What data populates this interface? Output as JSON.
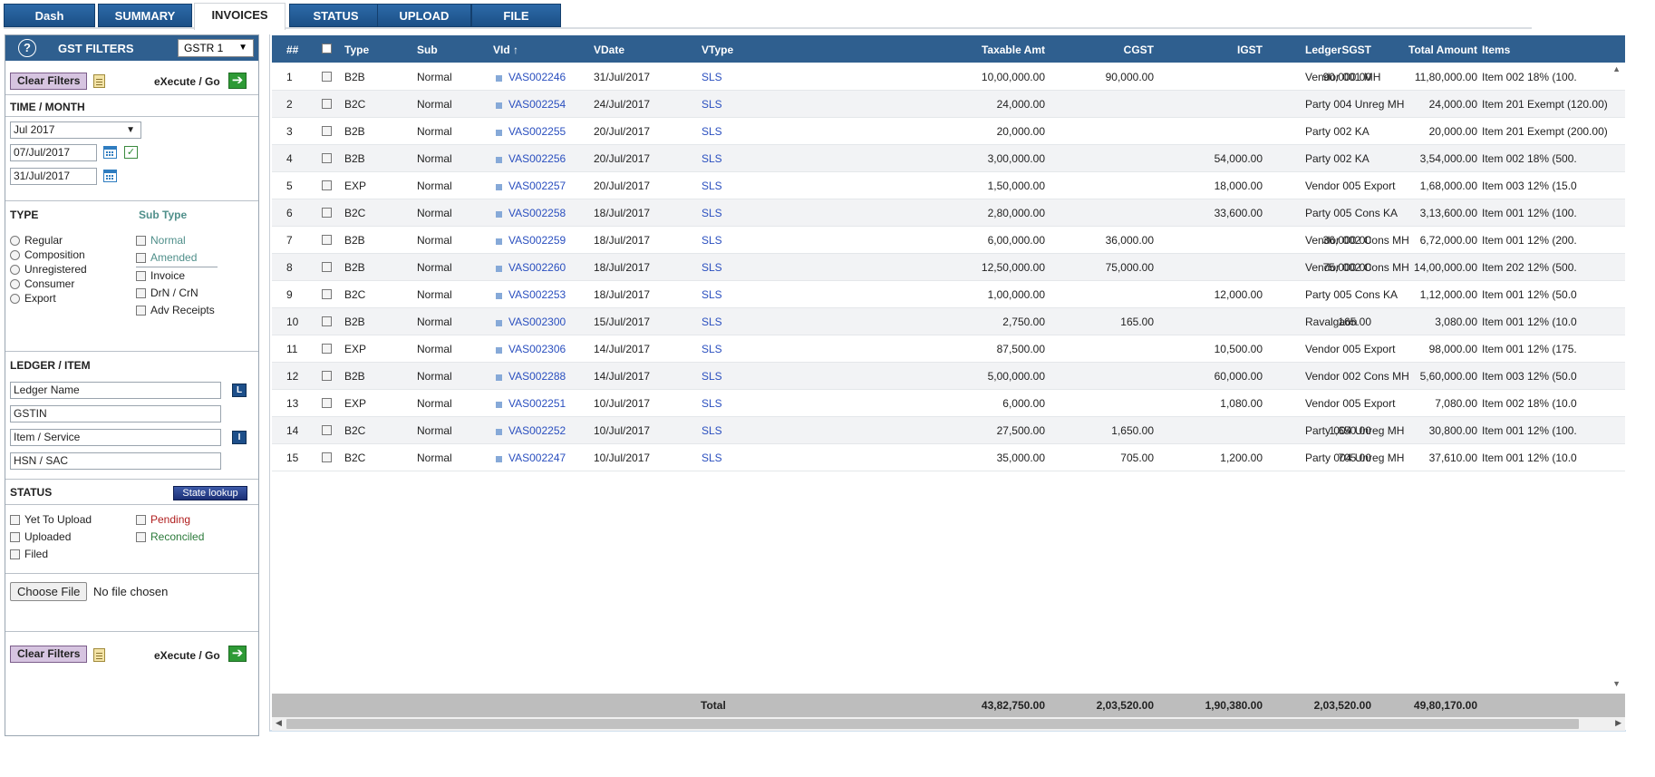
{
  "tabs": [
    "Dash",
    "SUMMARY",
    "INVOICES",
    "STATUS",
    "UPLOAD",
    "FILE"
  ],
  "sidebar": {
    "title": "GST FILTERS",
    "gstr_value": "GSTR 1",
    "clear_label": "Clear Filters",
    "execute_label": "eXecute / Go",
    "time_title": "TIME / MONTH",
    "month_value": "Jul 2017",
    "from_date": "07/Jul/2017",
    "to_date": "31/Jul/2017",
    "type_title": "TYPE",
    "subtype_title": "Sub Type",
    "types": [
      "Regular",
      "Composition",
      "Unregistered",
      "Consumer",
      "Export"
    ],
    "subtypes": [
      "Normal",
      "Amended"
    ],
    "doc_types": [
      "Invoice",
      "DrN / CrN",
      "Adv Receipts"
    ],
    "ledger_title": "LEDGER / ITEM",
    "ledger_placeholder": "Ledger Name",
    "gstin_placeholder": "GSTIN",
    "item_placeholder": "Item / Service",
    "hsn_placeholder": "HSN / SAC",
    "ledger_btn": "L",
    "item_btn": "I",
    "status_title": "STATUS",
    "state_lookup": "State lookup",
    "status_left": [
      "Yet To Upload",
      "Uploaded",
      "Filed"
    ],
    "status_pending": "Pending",
    "status_reconciled": "Reconciled",
    "choose_file": "Choose File",
    "no_file": "No file chosen"
  },
  "grid": {
    "headers": {
      "num": "##",
      "type": "Type",
      "sub": "Sub",
      "vid": "VId",
      "vdate": "VDate",
      "vtype": "VType",
      "taxable": "Taxable Amt",
      "cgst": "CGST",
      "igst": "IGST",
      "sgst": "SGST",
      "total": "Total Amount",
      "ledger": "Ledger",
      "items": "Items"
    },
    "sort_indicator": "↑",
    "rows": [
      {
        "n": "1",
        "type": "B2B",
        "sub": "Normal",
        "vid": "VAS002246",
        "vdate": "31/Jul/2017",
        "vtype": "SLS",
        "taxable": "10,00,000.00",
        "cgst": "90,000.00",
        "igst": "",
        "sgst": "90,000.00",
        "total": "11,80,000.00",
        "ledger": "Vendor 001 MH",
        "items": "Item 002 18% (100."
      },
      {
        "n": "2",
        "type": "B2C",
        "sub": "Normal",
        "vid": "VAS002254",
        "vdate": "24/Jul/2017",
        "vtype": "SLS",
        "taxable": "24,000.00",
        "cgst": "",
        "igst": "",
        "sgst": "",
        "total": "24,000.00",
        "ledger": "Party 004 Unreg MH",
        "items": "Item 201 Exempt (120.00)"
      },
      {
        "n": "3",
        "type": "B2B",
        "sub": "Normal",
        "vid": "VAS002255",
        "vdate": "20/Jul/2017",
        "vtype": "SLS",
        "taxable": "20,000.00",
        "cgst": "",
        "igst": "",
        "sgst": "",
        "total": "20,000.00",
        "ledger": "Party 002 KA",
        "items": "Item 201 Exempt (200.00)"
      },
      {
        "n": "4",
        "type": "B2B",
        "sub": "Normal",
        "vid": "VAS002256",
        "vdate": "20/Jul/2017",
        "vtype": "SLS",
        "taxable": "3,00,000.00",
        "cgst": "",
        "igst": "54,000.00",
        "sgst": "",
        "total": "3,54,000.00",
        "ledger": "Party 002 KA",
        "items": "Item 002 18% (500."
      },
      {
        "n": "5",
        "type": "EXP",
        "sub": "Normal",
        "vid": "VAS002257",
        "vdate": "20/Jul/2017",
        "vtype": "SLS",
        "taxable": "1,50,000.00",
        "cgst": "",
        "igst": "18,000.00",
        "sgst": "",
        "total": "1,68,000.00",
        "ledger": "Vendor 005 Export",
        "items": "Item 003 12% (15.0"
      },
      {
        "n": "6",
        "type": "B2C",
        "sub": "Normal",
        "vid": "VAS002258",
        "vdate": "18/Jul/2017",
        "vtype": "SLS",
        "taxable": "2,80,000.00",
        "cgst": "",
        "igst": "33,600.00",
        "sgst": "",
        "total": "3,13,600.00",
        "ledger": "Party 005 Cons KA",
        "items": "Item 001 12% (100."
      },
      {
        "n": "7",
        "type": "B2B",
        "sub": "Normal",
        "vid": "VAS002259",
        "vdate": "18/Jul/2017",
        "vtype": "SLS",
        "taxable": "6,00,000.00",
        "cgst": "36,000.00",
        "igst": "",
        "sgst": "36,000.00",
        "total": "6,72,000.00",
        "ledger": "Vendor 002 Cons MH",
        "items": "Item 001 12% (200."
      },
      {
        "n": "8",
        "type": "B2B",
        "sub": "Normal",
        "vid": "VAS002260",
        "vdate": "18/Jul/2017",
        "vtype": "SLS",
        "taxable": "12,50,000.00",
        "cgst": "75,000.00",
        "igst": "",
        "sgst": "75,000.00",
        "total": "14,00,000.00",
        "ledger": "Vendor 002 Cons MH",
        "items": "Item 202 12% (500."
      },
      {
        "n": "9",
        "type": "B2C",
        "sub": "Normal",
        "vid": "VAS002253",
        "vdate": "18/Jul/2017",
        "vtype": "SLS",
        "taxable": "1,00,000.00",
        "cgst": "",
        "igst": "12,000.00",
        "sgst": "",
        "total": "1,12,000.00",
        "ledger": "Party 005 Cons KA",
        "items": "Item 001 12% (50.0"
      },
      {
        "n": "10",
        "type": "B2B",
        "sub": "Normal",
        "vid": "VAS002300",
        "vdate": "15/Jul/2017",
        "vtype": "SLS",
        "taxable": "2,750.00",
        "cgst": "165.00",
        "igst": "",
        "sgst": "165.00",
        "total": "3,080.00",
        "ledger": "Ravalgaon",
        "items": "Item 001 12% (10.0"
      },
      {
        "n": "11",
        "type": "EXP",
        "sub": "Normal",
        "vid": "VAS002306",
        "vdate": "14/Jul/2017",
        "vtype": "SLS",
        "taxable": "87,500.00",
        "cgst": "",
        "igst": "10,500.00",
        "sgst": "",
        "total": "98,000.00",
        "ledger": "Vendor 005 Export",
        "items": "Item 001 12% (175."
      },
      {
        "n": "12",
        "type": "B2B",
        "sub": "Normal",
        "vid": "VAS002288",
        "vdate": "14/Jul/2017",
        "vtype": "SLS",
        "taxable": "5,00,000.00",
        "cgst": "",
        "igst": "60,000.00",
        "sgst": "",
        "total": "5,60,000.00",
        "ledger": "Vendor 002 Cons MH",
        "items": "Item 003 12% (50.0"
      },
      {
        "n": "13",
        "type": "EXP",
        "sub": "Normal",
        "vid": "VAS002251",
        "vdate": "10/Jul/2017",
        "vtype": "SLS",
        "taxable": "6,000.00",
        "cgst": "",
        "igst": "1,080.00",
        "sgst": "",
        "total": "7,080.00",
        "ledger": "Vendor 005 Export",
        "items": "Item 002 18% (10.0"
      },
      {
        "n": "14",
        "type": "B2C",
        "sub": "Normal",
        "vid": "VAS002252",
        "vdate": "10/Jul/2017",
        "vtype": "SLS",
        "taxable": "27,500.00",
        "cgst": "1,650.00",
        "igst": "",
        "sgst": "1,650.00",
        "total": "30,800.00",
        "ledger": "Party 004 Unreg MH",
        "items": "Item 001 12% (100."
      },
      {
        "n": "15",
        "type": "B2C",
        "sub": "Normal",
        "vid": "VAS002247",
        "vdate": "10/Jul/2017",
        "vtype": "SLS",
        "taxable": "35,000.00",
        "cgst": "705.00",
        "igst": "1,200.00",
        "sgst": "705.00",
        "total": "37,610.00",
        "ledger": "Party 004 Unreg MH",
        "items": "Item 001 12% (10.0"
      }
    ],
    "totals": {
      "label": "Total",
      "taxable": "43,82,750.00",
      "cgst": "2,03,520.00",
      "igst": "1,90,380.00",
      "sgst": "2,03,520.00",
      "total": "49,80,170.00"
    }
  }
}
